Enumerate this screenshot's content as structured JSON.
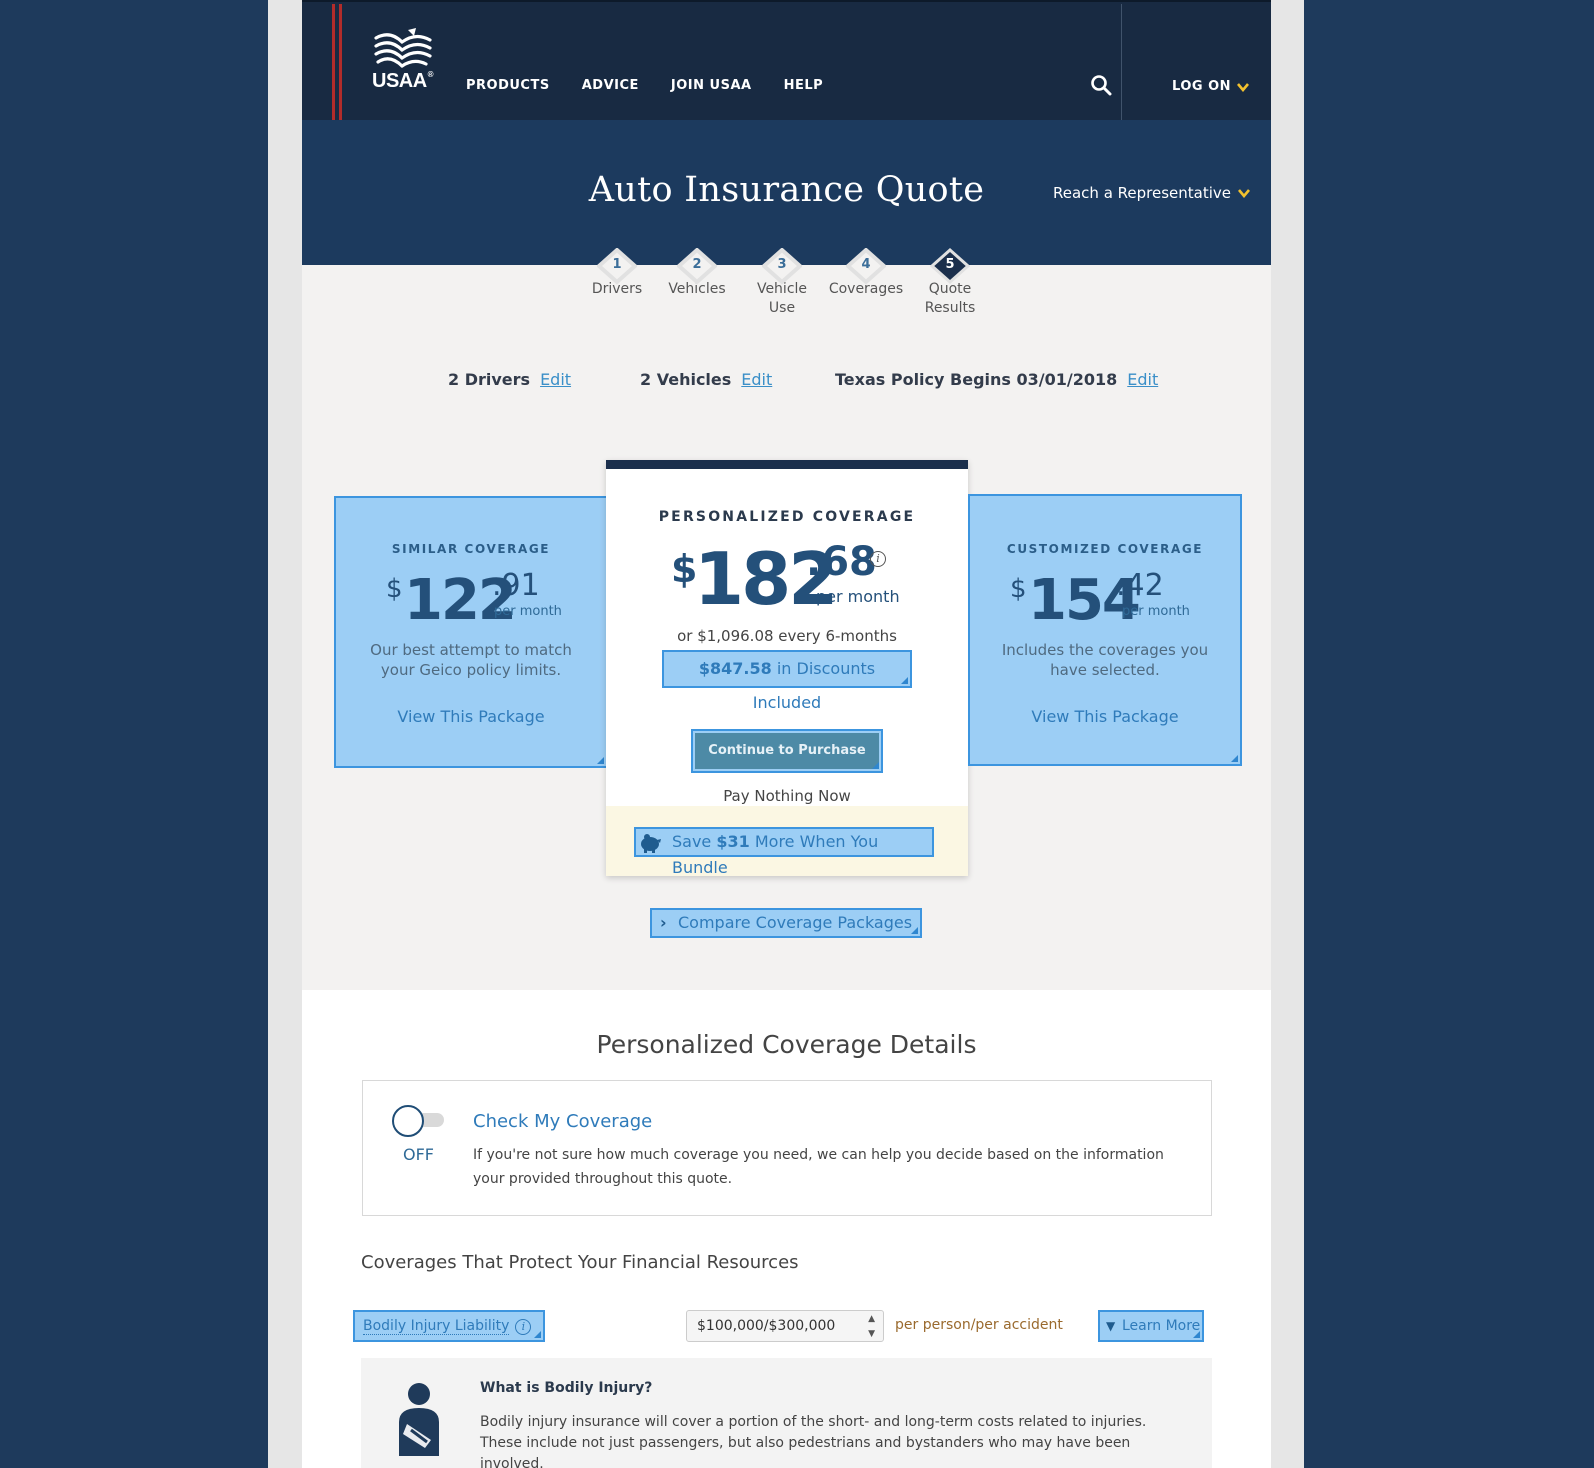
{
  "nav": {
    "logo_text": "USAA",
    "logo_reg": "®",
    "links": [
      "PRODUCTS",
      "ADVICE",
      "JOIN USAA",
      "HELP"
    ],
    "logon": "LOG ON"
  },
  "hero": {
    "title": "Auto Insurance Quote",
    "reach": "Reach a Representative"
  },
  "steps": [
    {
      "num": "1",
      "label": "Drivers"
    },
    {
      "num": "2",
      "label": "Vehicles"
    },
    {
      "num": "3",
      "label": "Vehicle\nUse"
    },
    {
      "num": "4",
      "label": "Coverages"
    },
    {
      "num": "5",
      "label": "Quote\nResults"
    }
  ],
  "summary": {
    "drivers": "2 Drivers",
    "vehicles": "2 Vehicles",
    "policy": "Texas Policy Begins 03/01/2018",
    "edit": "Edit"
  },
  "cards": {
    "similar": {
      "title": "SIMILAR COVERAGE",
      "dollar": "$",
      "main": "122",
      "cents": ".91",
      "per": "per month",
      "desc1": "Our best attempt to match",
      "desc2": "your Geico policy limits.",
      "link": "View This Package"
    },
    "personalized": {
      "title": "PERSONALIZED COVERAGE",
      "dollar": "$",
      "main": "182",
      "cents": ".68",
      "info": "i",
      "per": "per month",
      "or_line": "or $1,096.08 every 6-months",
      "discount_amount": "$847.58",
      "discount_text": " in Discounts Included",
      "cta": "Continue to Purchase",
      "pay": "Pay Nothing Now",
      "bundle_pre": "Save ",
      "bundle_amount": "$31",
      "bundle_post": " More When You Bundle"
    },
    "customized": {
      "title": "CUSTOMIZED COVERAGE",
      "dollar": "$",
      "main": "154",
      "cents": ".42",
      "per": "per month",
      "desc1": "Includes the coverages you",
      "desc2": "have selected.",
      "link": "View This Package"
    }
  },
  "compare": "Compare Coverage Packages",
  "details": {
    "title": "Personalized Coverage Details",
    "check_title": "Check My Coverage",
    "toggle_state": "OFF",
    "check_desc": "If you're not sure how much coverage you need, we can help you decide based on the information your provided throughout this quote.",
    "section_title": "Coverages That Protect Your Financial Resources",
    "coverage_label": "Bodily Injury Liability",
    "coverage_info": "i",
    "coverage_value": "$100,000/$300,000",
    "coverage_unit": "per person/per accident",
    "learn_more": "Learn More",
    "q": "What is Bodily Injury?",
    "a": "Bodily injury insurance will cover a portion of the short- and long-term costs related to injuries. These include not just passengers, but also pedestrians and bystanders who may have been involved."
  },
  "colors": {
    "navy": "#182a42",
    "hero": "#1c3a5e",
    "highlight_fill": "#9ccef5",
    "highlight_border": "#3c95df",
    "accent_gold": "#f2c12e",
    "brand_red": "#b22c2a"
  }
}
